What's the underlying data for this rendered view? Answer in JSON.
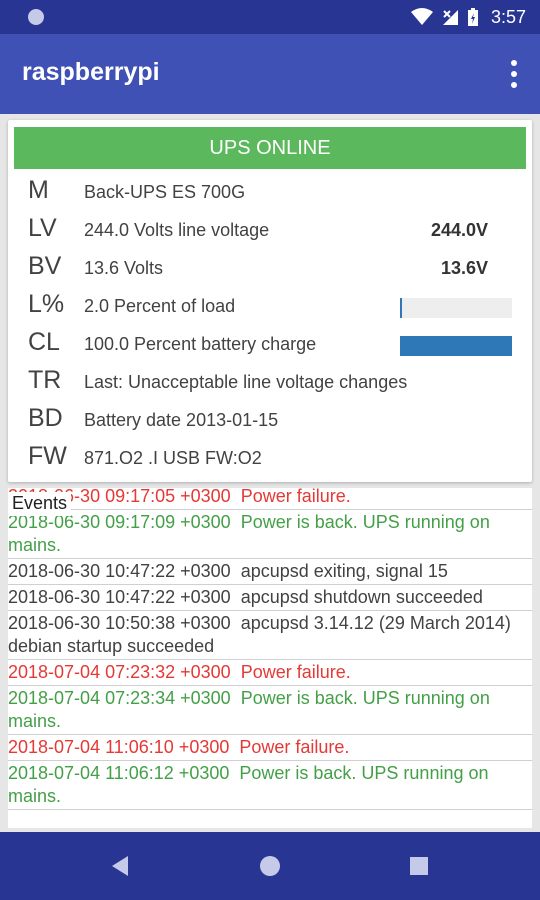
{
  "status_bar": {
    "time": "3:57"
  },
  "app": {
    "title": "raspberrypi"
  },
  "ups": {
    "status": "UPS ONLINE",
    "status_color": "#5cb85c",
    "rows": [
      {
        "key": "M",
        "desc": "Back-UPS ES 700G",
        "value": ""
      },
      {
        "key": "LV",
        "desc": "244.0 Volts line voltage",
        "value": "244.0V"
      },
      {
        "key": "BV",
        "desc": "13.6 Volts",
        "value": "13.6V"
      },
      {
        "key": "L%",
        "desc": "2.0 Percent of load",
        "value": "",
        "bar_percent": 2.0
      },
      {
        "key": "CL",
        "desc": "100.0 Percent battery charge",
        "value": "",
        "bar_percent": 100.0
      },
      {
        "key": "TR",
        "desc": "Last: Unacceptable line voltage changes",
        "value": ""
      },
      {
        "key": "BD",
        "desc": "Battery date 2013-01-15",
        "value": ""
      },
      {
        "key": "FW",
        "desc": "871.O2 .I USB FW:O2",
        "value": ""
      }
    ]
  },
  "events": {
    "label": "Events",
    "items": [
      {
        "ts": "2018-06-30 09:17:05 +0300",
        "msg": "Power failure.",
        "kind": "fail"
      },
      {
        "ts": "2018-06-30 09:17:09 +0300",
        "msg": "Power is back. UPS running on mains.",
        "kind": "ok"
      },
      {
        "ts": "2018-06-30 10:47:22 +0300",
        "msg": "apcupsd exiting, signal 15",
        "kind": "info"
      },
      {
        "ts": "2018-06-30 10:47:22 +0300",
        "msg": "apcupsd shutdown succeeded",
        "kind": "info"
      },
      {
        "ts": "2018-06-30 10:50:38 +0300",
        "msg": "apcupsd 3.14.12 (29 March 2014) debian startup succeeded",
        "kind": "info"
      },
      {
        "ts": "2018-07-04 07:23:32 +0300",
        "msg": "Power failure.",
        "kind": "fail"
      },
      {
        "ts": "2018-07-04 07:23:34 +0300",
        "msg": "Power is back. UPS running on mains.",
        "kind": "ok"
      },
      {
        "ts": "2018-07-04 11:06:10 +0300",
        "msg": "Power failure.",
        "kind": "fail"
      },
      {
        "ts": "2018-07-04 11:06:12 +0300",
        "msg": "Power is back. UPS running on mains.",
        "kind": "ok"
      }
    ]
  },
  "colors": {
    "fail": "#e53935",
    "ok": "#43a047",
    "info": "#424242",
    "bar": "#2e78b7"
  }
}
